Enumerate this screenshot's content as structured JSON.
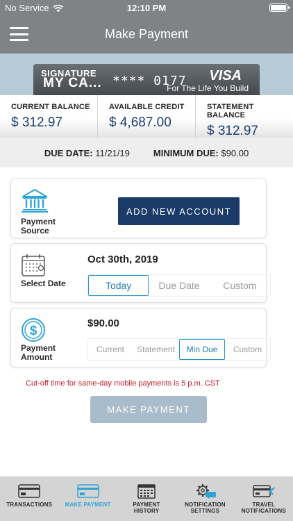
{
  "status_bar": {
    "carrier": "No Service",
    "time": "12:10 PM",
    "battery_level": 1.0
  },
  "header": {
    "title": "Make Payment",
    "menu_icon": "hamburger-icon"
  },
  "card": {
    "brand_line1": "SIGNATURE",
    "brand_line2": "MY CA...",
    "masked_number": "**** 0177",
    "network": "VISA",
    "tagline": "For The Life You Build"
  },
  "balances": [
    {
      "label": "CURRENT BALANCE",
      "value": "$ 312.97"
    },
    {
      "label": "AVAILABLE CREDIT",
      "value": "$ 4,687.00"
    },
    {
      "label": "STATEMENT BALANCE",
      "value": "$ 312.97"
    }
  ],
  "due": {
    "due_date_label": "DUE DATE:",
    "due_date_value": "11/21/19",
    "minimum_label": "MINIMUM DUE:",
    "minimum_value": "$90.00"
  },
  "payment_source": {
    "label": "Payment Source",
    "button": "ADD NEW ACCOUNT",
    "icon": "bank-icon"
  },
  "select_date": {
    "label": "Select Date",
    "value": "Oct 30th, 2019",
    "icon": "calendar-icon",
    "options": [
      "Today",
      "Due Date",
      "Custom"
    ],
    "selected": "Today"
  },
  "payment_amount": {
    "label": "Payment Amount",
    "value": "$90.00",
    "icon": "dollar-coin-icon",
    "options": [
      "Current",
      "Statement",
      "Min Due",
      "Custom"
    ],
    "selected": "Min Due"
  },
  "cutoff_note": "Cut-off time for same-day mobile payments is 5 p.m. CST",
  "submit_button": "MAKE PAYMENT",
  "tab_bar": [
    {
      "line1": "TRANSACTIONS",
      "line2": "",
      "icon": "credit-card-icon"
    },
    {
      "line1": "MAKE PAYMENT",
      "line2": "",
      "icon": "payment-card-icon",
      "active": true
    },
    {
      "line1": "PAYMENT",
      "line2": "HISTORY",
      "icon": "calendar-grid-icon"
    },
    {
      "line1": "NOTIFICATION",
      "line2": "SETTINGS",
      "icon": "gear-chat-icon"
    },
    {
      "line1": "TRAVEL",
      "line2": "NOTIFICATIONS",
      "icon": "card-plane-icon"
    }
  ],
  "colors": {
    "header_bg": "#7f8385",
    "navy": "#1a3a67",
    "accent_blue": "#2ea4d6",
    "disabled_button": "#a9bccb",
    "warning_red": "#c21b2a"
  }
}
